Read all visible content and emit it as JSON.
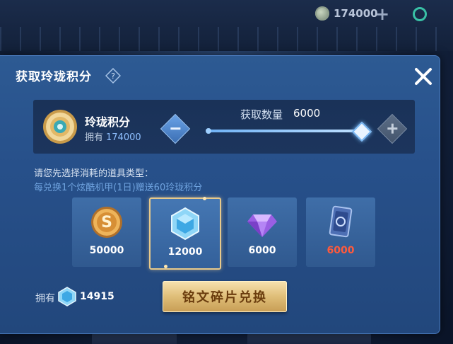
{
  "top_bar": {
    "currency_value": "174000"
  },
  "dialog": {
    "title": "获取玲珑积分",
    "close_symbol": "✕",
    "points_panel": {
      "name": "玲珑积分",
      "owned_label": "拥有",
      "owned_value": "174000",
      "quantity_label": "获取数量",
      "quantity_value": "6000",
      "slider_fraction": 1.0
    },
    "hint_primary": "请您先选择消耗的道具类型：",
    "hint_secondary": "每兑换1个炫酷机甲(1日)赠送60玲珑积分",
    "items": [
      {
        "value": "50000",
        "icon": "gold-coin-icon",
        "selected": false,
        "insufficient": false
      },
      {
        "value": "12000",
        "icon": "inscription-fragment-icon",
        "selected": true,
        "insufficient": false
      },
      {
        "value": "6000",
        "icon": "purple-diamond-icon",
        "selected": false,
        "insufficient": false
      },
      {
        "value": "6000",
        "icon": "card-ticket-icon",
        "selected": false,
        "insufficient": true
      }
    ],
    "owned_label": "拥有",
    "owned_fragments": "14915",
    "exchange_button": "铭文碎片兑换"
  },
  "colors": {
    "dialog_bg": "#2d5a93",
    "accent_blue": "#8fc0ff",
    "gold_button": "#dfbe78",
    "insufficient_red": "#ff5a3c"
  }
}
